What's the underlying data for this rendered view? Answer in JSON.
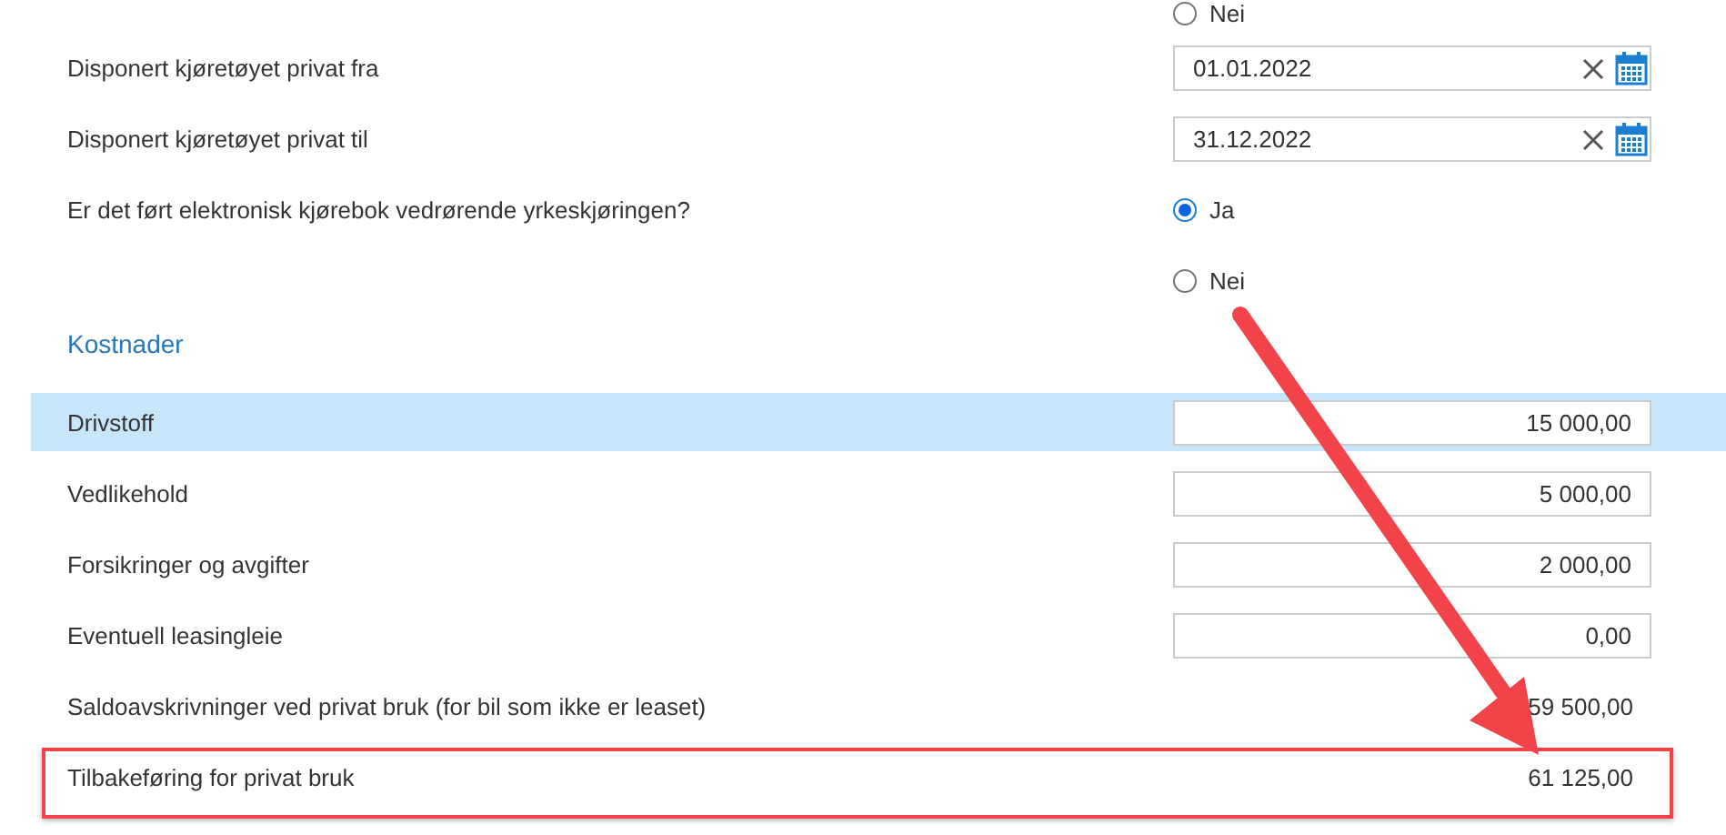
{
  "top_radio": {
    "label": "Nei",
    "selected": false
  },
  "date_fields": [
    {
      "label": "Disponert kjøretøyet privat fra",
      "value": "01.01.2022"
    },
    {
      "label": "Disponert kjøretøyet privat til",
      "value": "31.12.2022"
    }
  ],
  "question": {
    "label": "Er det ført elektronisk kjørebok vedrørende yrkeskjøringen?",
    "options": [
      {
        "label": "Ja",
        "selected": true
      },
      {
        "label": "Nei",
        "selected": false
      }
    ]
  },
  "section_title": "Kostnader",
  "costs": [
    {
      "kind": "input",
      "label": "Drivstoff",
      "value": "15 000,00",
      "selected": true,
      "framed": false
    },
    {
      "kind": "input",
      "label": "Vedlikehold",
      "value": "5 000,00",
      "selected": false,
      "framed": false
    },
    {
      "kind": "input",
      "label": "Forsikringer og avgifter",
      "value": "2 000,00",
      "selected": false,
      "framed": false
    },
    {
      "kind": "input",
      "label": "Eventuell leasingleie",
      "value": "0,00",
      "selected": false,
      "framed": false
    },
    {
      "kind": "text",
      "label": "Saldoavskrivninger ved privat bruk (for bil som ikke er leaset)",
      "value": "59 500,00",
      "selected": false,
      "framed": false
    },
    {
      "kind": "text",
      "label": "Tilbakeføring for privat bruk",
      "value": "61 125,00",
      "selected": false,
      "framed": true
    }
  ],
  "overlay": {
    "arrow": true
  }
}
